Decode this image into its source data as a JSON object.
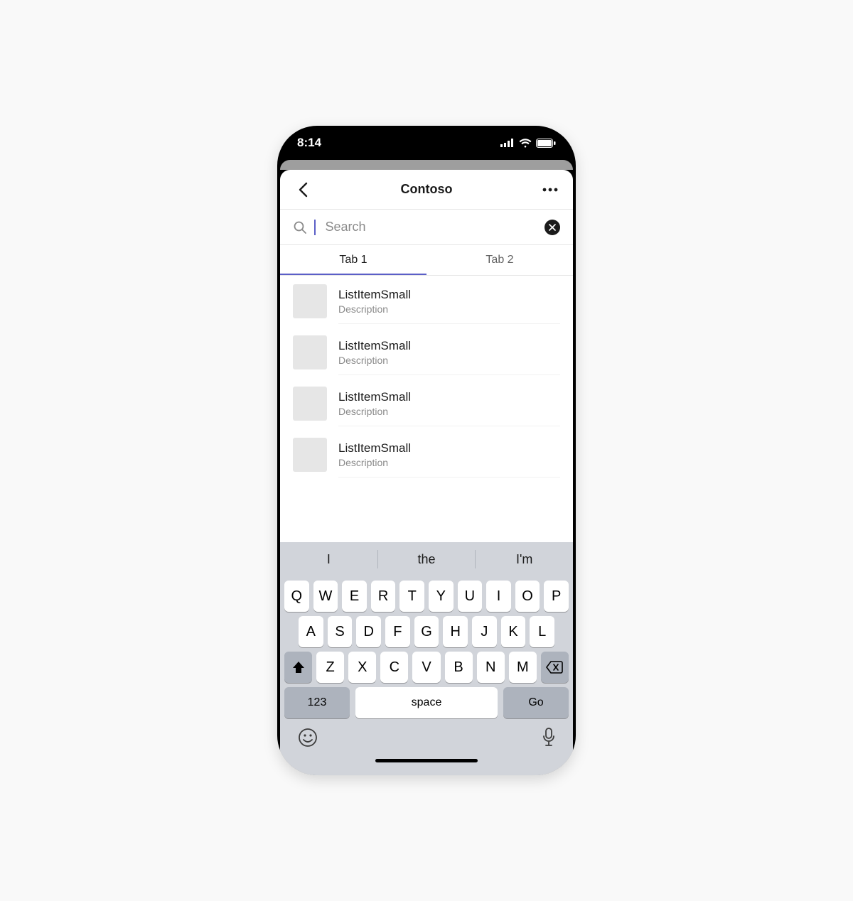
{
  "status": {
    "time": "8:14"
  },
  "nav": {
    "title": "Contoso"
  },
  "search": {
    "placeholder": "Search",
    "value": ""
  },
  "tabs": [
    {
      "label": "Tab 1",
      "active": true
    },
    {
      "label": "Tab 2",
      "active": false
    }
  ],
  "list": [
    {
      "title": "ListItemSmall",
      "desc": "Description"
    },
    {
      "title": "ListItemSmall",
      "desc": "Description"
    },
    {
      "title": "ListItemSmall",
      "desc": "Description"
    },
    {
      "title": "ListItemSmall",
      "desc": "Description"
    }
  ],
  "keyboard": {
    "predictions": [
      "I",
      "the",
      "I'm"
    ],
    "row1": [
      "Q",
      "W",
      "E",
      "R",
      "T",
      "Y",
      "U",
      "I",
      "O",
      "P"
    ],
    "row2": [
      "A",
      "S",
      "D",
      "F",
      "G",
      "H",
      "J",
      "K",
      "L"
    ],
    "row3": [
      "Z",
      "X",
      "C",
      "V",
      "B",
      "N",
      "M"
    ],
    "numKey": "123",
    "spaceKey": "space",
    "goKey": "Go"
  }
}
